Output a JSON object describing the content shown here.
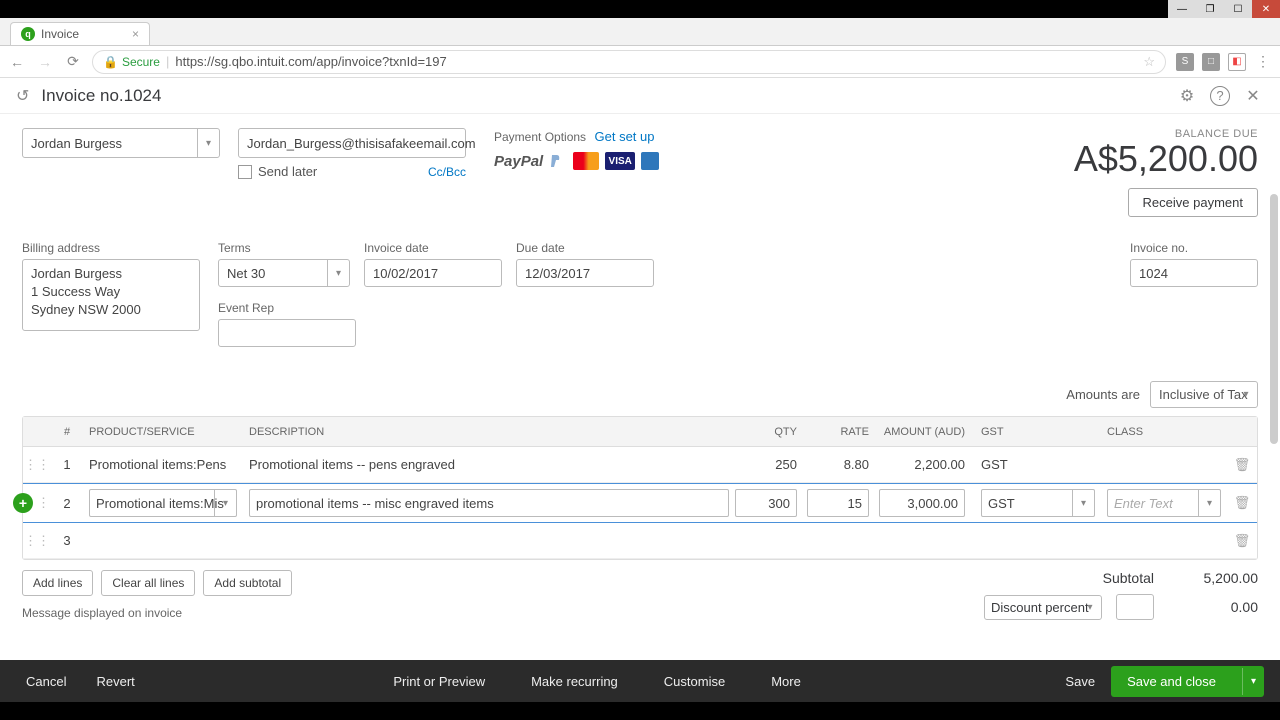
{
  "browser": {
    "tab_title": "Invoice",
    "url": "https://sg.qbo.intuit.com/app/invoice?txnId=197",
    "secure_label": "Secure"
  },
  "header": {
    "title": "Invoice no.1024"
  },
  "customer": {
    "name": "Jordan Burgess",
    "email": "Jordan_Burgess@thisisafakeemail.com",
    "ccbcc": "Cc/Bcc",
    "send_later": "Send later"
  },
  "payment": {
    "label": "Payment Options",
    "setup": "Get set up",
    "paypal": "PayPal",
    "visa": "VISA"
  },
  "balance": {
    "label": "BALANCE DUE",
    "amount": "A$5,200.00",
    "receive_btn": "Receive payment"
  },
  "fields": {
    "billing_label": "Billing address",
    "billing_value": "Jordan Burgess\n1 Success Way\nSydney NSW  2000",
    "terms_label": "Terms",
    "terms_value": "Net 30",
    "inv_date_label": "Invoice date",
    "inv_date_value": "10/02/2017",
    "due_date_label": "Due date",
    "due_date_value": "12/03/2017",
    "event_rep_label": "Event Rep",
    "event_rep_value": "",
    "inv_no_label": "Invoice no.",
    "inv_no_value": "1024"
  },
  "amounts_are": {
    "label": "Amounts are",
    "value": "Inclusive of Tax"
  },
  "grid": {
    "headers": {
      "num": "#",
      "prod": "PRODUCT/SERVICE",
      "desc": "DESCRIPTION",
      "qty": "QTY",
      "rate": "RATE",
      "amount": "AMOUNT (AUD)",
      "gst": "GST",
      "class": "CLASS"
    },
    "rows": [
      {
        "num": "1",
        "prod": "Promotional items:Pens",
        "desc": "Promotional items -- pens engraved",
        "qty": "250",
        "rate": "8.80",
        "amount": "2,200.00",
        "gst": "GST",
        "class": ""
      },
      {
        "num": "2",
        "prod": "Promotional items:Mis",
        "desc": "promotional items -- misc engraved items",
        "qty": "300",
        "rate": "15",
        "amount": "3,000.00",
        "gst": "GST",
        "class_placeholder": "Enter Text"
      },
      {
        "num": "3",
        "prod": "",
        "desc": "",
        "qty": "",
        "rate": "",
        "amount": "",
        "gst": "",
        "class": ""
      }
    ],
    "add_lines": "Add lines",
    "clear_lines": "Clear all lines",
    "add_subtotal": "Add subtotal"
  },
  "totals": {
    "subtotal_label": "Subtotal",
    "subtotal_value": "5,200.00",
    "discount_label": "Discount percent",
    "discount_value": "0.00"
  },
  "message_label": "Message displayed on invoice",
  "footer": {
    "cancel": "Cancel",
    "revert": "Revert",
    "print": "Print or Preview",
    "recurring": "Make recurring",
    "customise": "Customise",
    "more": "More",
    "save": "Save",
    "save_close": "Save and close"
  }
}
